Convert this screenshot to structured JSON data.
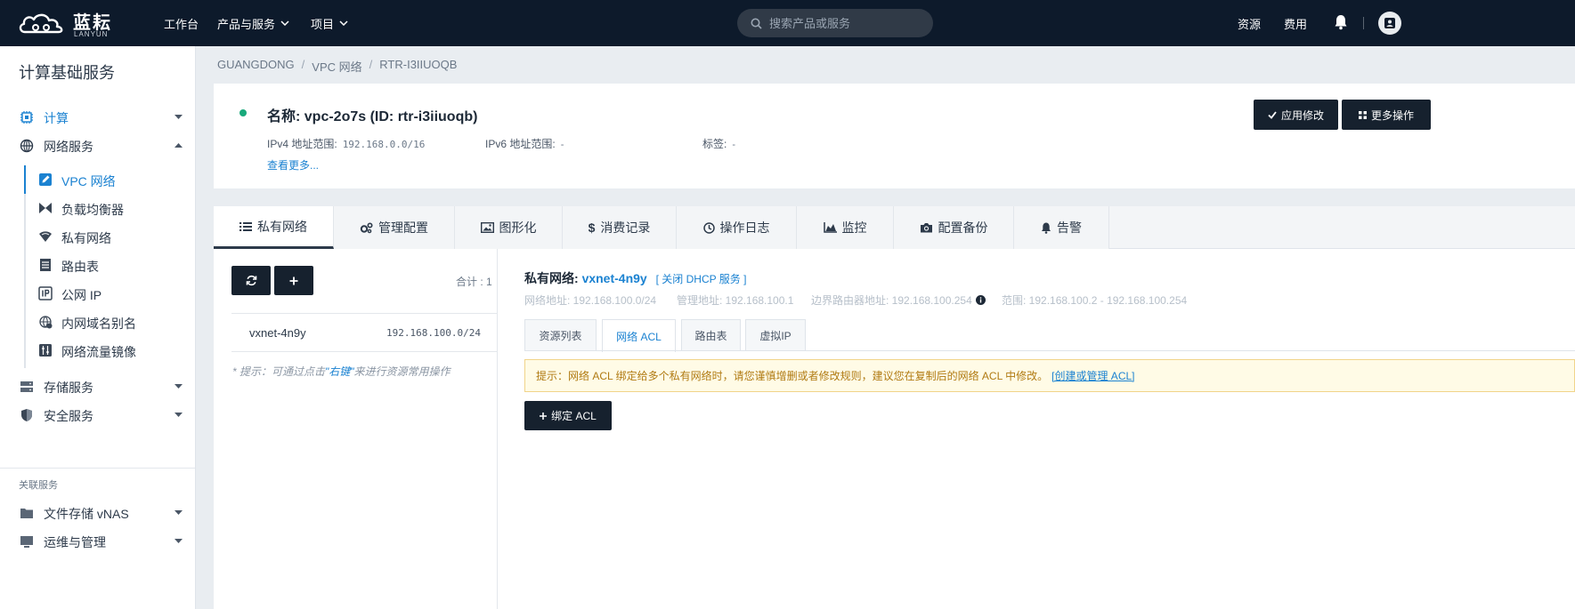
{
  "brand": {
    "name_cn": "蓝耘",
    "name_en": "LANYUN"
  },
  "topnav": {
    "workbench": "工作台",
    "products": "产品与服务",
    "projects": "项目",
    "search_placeholder": "搜索产品或服务",
    "resources": "资源",
    "billing": "费用"
  },
  "sidebar": {
    "title": "计算基础服务",
    "compute": "计算",
    "network": "网络服务",
    "network_items": [
      "VPC 网络",
      "负载均衡器",
      "私有网络",
      "路由表",
      "公网 IP",
      "内网域名别名",
      "网络流量镜像"
    ],
    "storage": "存储服务",
    "security": "安全服务",
    "related_section": "关联服务",
    "vnas": "文件存储 vNAS",
    "ops": "运维与管理"
  },
  "breadcrumb": [
    "GUANGDONG",
    "VPC 网络",
    "RTR-I3IIUOQB"
  ],
  "resource": {
    "name": "名称: vpc-2o7s (ID: rtr-i3iiuoqb)",
    "ipv4_label": "IPv4 地址范围:",
    "ipv4_value": "192.168.0.0/16",
    "ipv6_label": "IPv6 地址范围:",
    "ipv6_value": "-",
    "tags_label": "标签:",
    "tags_value": "-",
    "see_more": "查看更多...",
    "apply_button": "应用修改",
    "more_button": "更多操作"
  },
  "tabs": [
    "私有网络",
    "管理配置",
    "图形化",
    "消费记录",
    "操作日志",
    "监控",
    "配置备份",
    "告警"
  ],
  "list": {
    "total": "合计 : 1",
    "rows": [
      {
        "name": "vxnet-4n9y",
        "cidr": "192.168.100.0/24"
      }
    ],
    "hint_prefix": "* 提示：可通过点击",
    "hint_keyword": "\"右键\"",
    "hint_suffix": "来进行资源常用操作"
  },
  "detail": {
    "title_label": "私有网络:",
    "title_name": "vxnet-4n9y",
    "dhcp_link": "[ 关闭 DHCP 服务 ]",
    "net_addr": "网络地址: 192.168.100.0/24",
    "mgmt_addr": "管理地址: 192.168.100.1",
    "border_router": "边界路由器地址: 192.168.100.254",
    "range": "范围: 192.168.100.2 - 192.168.100.254",
    "subtabs": [
      "资源列表",
      "网络 ACL",
      "路由表",
      "虚拟IP"
    ],
    "alert_text": "提示：网络 ACL 绑定给多个私有网络时，请您谨慎增删或者修改规则，建议您在复制后的网络 ACL 中修改。",
    "alert_link": "[创建或管理 ACL]",
    "bind_acl_button": "绑定 ACL"
  },
  "colors": {
    "topbar": "#0d1a2b",
    "accent": "#1b82d1",
    "dark_button": "#16212e",
    "status_ok": "#19a97b"
  }
}
